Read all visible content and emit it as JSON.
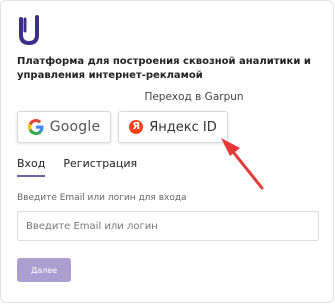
{
  "heading": "Платформа для построения сквозной аналитики и управления интернет-рекламой",
  "subheading": "Переход в Garpun",
  "providers": {
    "google_label": "Google",
    "yandex_label": "Яндекс ID",
    "yandex_icon_letter": "Я"
  },
  "tabs": [
    {
      "label": "Вход",
      "active": true
    },
    {
      "label": "Регистрация",
      "active": false
    }
  ],
  "login": {
    "field_label": "Введите Email или логин для входа",
    "placeholder": "Введите Email или логин",
    "value": ""
  },
  "next_button_label": "Далее",
  "colors": {
    "accent": "#6f63a8",
    "button_disabled": "#a99fd1",
    "arrow": "#e53935",
    "yandex_red": "#fc3f1d"
  }
}
